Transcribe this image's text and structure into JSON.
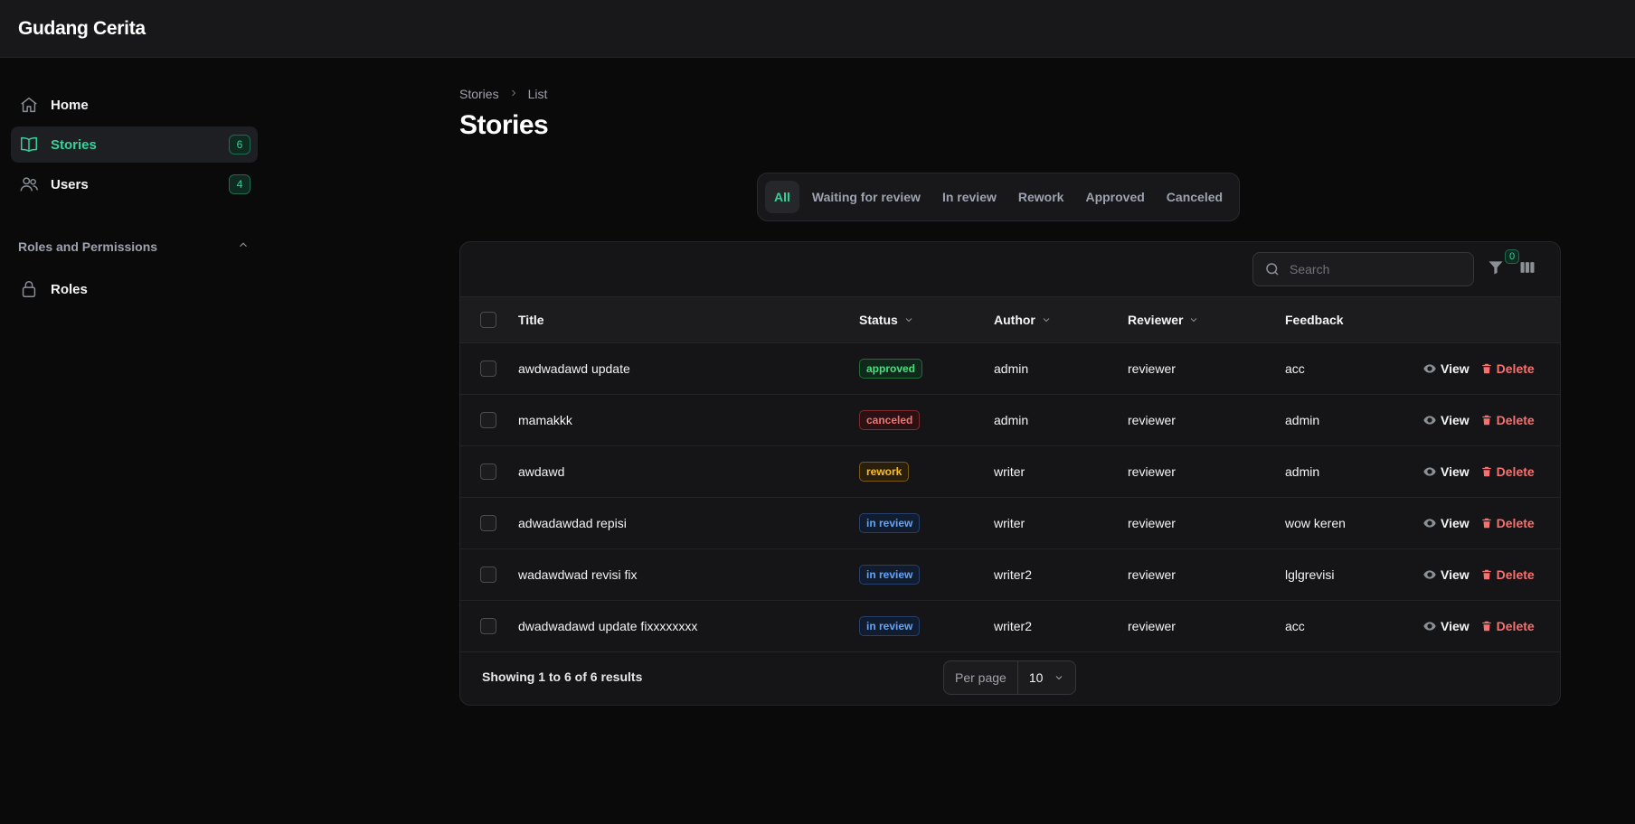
{
  "app": {
    "title": "Gudang Cerita"
  },
  "sidebar": {
    "items": [
      {
        "label": "Home",
        "icon": "home-icon"
      },
      {
        "label": "Stories",
        "icon": "book-icon",
        "badge": "6",
        "active": true
      },
      {
        "label": "Users",
        "icon": "users-icon",
        "badge": "4"
      }
    ],
    "group": {
      "label": "Roles and Permissions",
      "items": [
        {
          "label": "Roles",
          "icon": "lock-icon"
        }
      ]
    }
  },
  "breadcrumb": [
    "Stories",
    "List"
  ],
  "page_title": "Stories",
  "tabs": [
    "All",
    "Waiting for review",
    "In review",
    "Rework",
    "Approved",
    "Canceled"
  ],
  "active_tab": "All",
  "search": {
    "placeholder": "Search",
    "value": ""
  },
  "filter_count": "0",
  "table": {
    "columns": [
      "Title",
      "Status",
      "Author",
      "Reviewer",
      "Feedback"
    ],
    "rows": [
      {
        "title": "awdwadawd update",
        "status": "approved",
        "author": "admin",
        "reviewer": "reviewer",
        "feedback": "acc"
      },
      {
        "title": "mamakkk",
        "status": "canceled",
        "author": "admin",
        "reviewer": "reviewer",
        "feedback": "admin"
      },
      {
        "title": "awdawd",
        "status": "rework",
        "author": "writer",
        "reviewer": "reviewer",
        "feedback": "admin"
      },
      {
        "title": "adwadawdad repisi",
        "status": "in review",
        "author": "writer",
        "reviewer": "reviewer",
        "feedback": "wow keren"
      },
      {
        "title": "wadawdwad revisi fix",
        "status": "in review",
        "author": "writer2",
        "reviewer": "reviewer",
        "feedback": "lglgrevisi"
      },
      {
        "title": "dwadwadawd update fixxxxxxxx",
        "status": "in review",
        "author": "writer2",
        "reviewer": "reviewer",
        "feedback": "acc"
      }
    ],
    "actions": {
      "view": "View",
      "delete": "Delete"
    }
  },
  "footer": {
    "results": "Showing 1 to 6 of 6 results",
    "per_page_label": "Per page",
    "per_page_value": "10"
  },
  "colors": {
    "accent": "#34d399",
    "danger": "#f87171",
    "background": "#0a0a0b"
  }
}
